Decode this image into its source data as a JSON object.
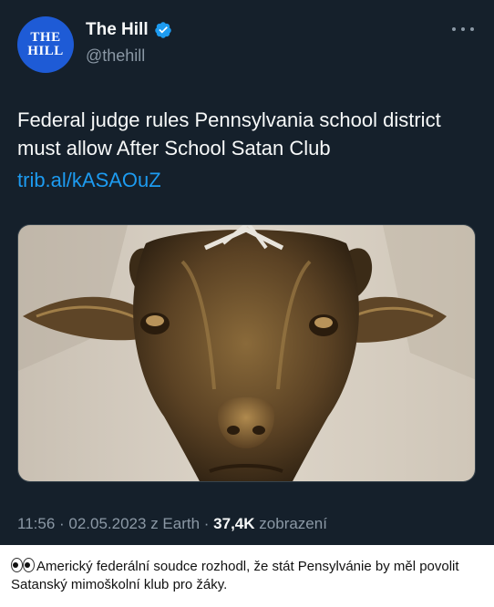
{
  "tweet": {
    "avatar_line1": "THE",
    "avatar_line2": "HILL",
    "display_name": "The Hill",
    "handle": "@thehill",
    "text": "Federal judge rules Pennsylvania school district must allow After School Satan Club",
    "link": "trib.al/kASAOuZ",
    "time_date": "11:56 · 02.05.2023 z Earth ·",
    "views_count": "37,4K",
    "views_label": "zobrazení"
  },
  "icons": {
    "verified": "verified-badge-icon",
    "more": "more-options-icon",
    "eyes": "eyes-emoji-icon"
  },
  "colors": {
    "background": "#15202b",
    "link": "#1d9bf0",
    "secondary_text": "#8b98a5",
    "avatar": "#1e5bd6"
  },
  "caption": {
    "text": "Americký federální soudce rozhodl, že stát Pensylvánie by měl povolit Satanský mimoškolní klub pro žáky."
  }
}
